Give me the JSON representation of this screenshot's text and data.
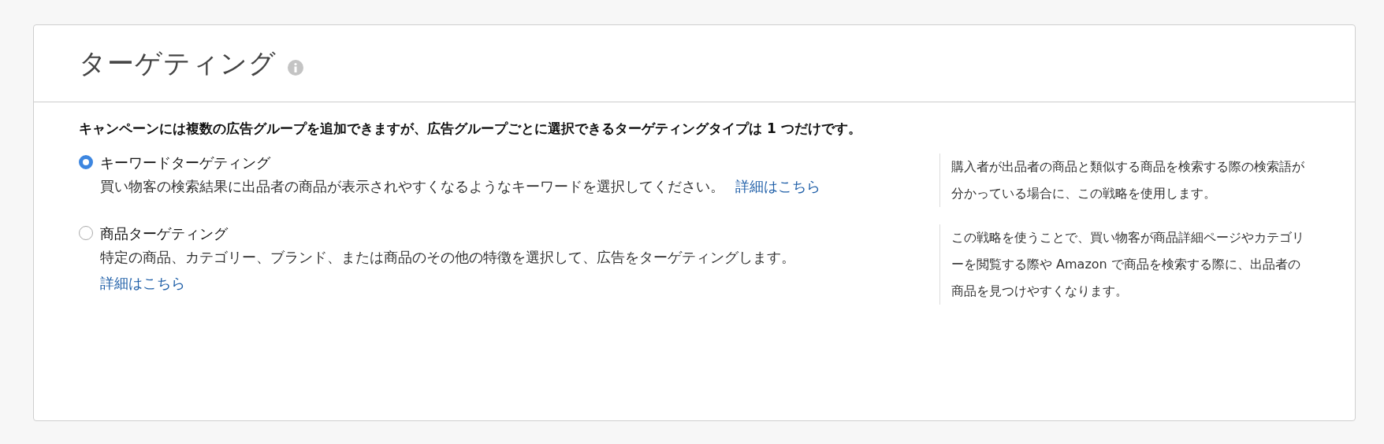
{
  "panel": {
    "title": "ターゲティング",
    "intro": "キャンペーンには複数の広告グループを追加できますが、広告グループごとに選択できるターゲティングタイプは 1 つだけです。",
    "options": [
      {
        "label": "キーワードターゲティング",
        "description": "買い物客の検索結果に出品者の商品が表示されやすくなるようなキーワードを選択してください。",
        "link": "詳細はこちら",
        "hint": "購入者が出品者の商品と類似する商品を検索する際の検索語が分かっている場合に、この戦略を使用します。",
        "selected": true
      },
      {
        "label": "商品ターゲティング",
        "description": "特定の商品、カテゴリー、ブランド、または商品のその他の特徴を選択して、広告をターゲティングします。",
        "link": "詳細はこちら",
        "hint": "この戦略を使うことで、買い物客が商品詳細ページやカテゴリーを閲覧する際や Amazon で商品を検索する際に、出品者の商品を見つけやすくなります。",
        "selected": false
      }
    ]
  }
}
